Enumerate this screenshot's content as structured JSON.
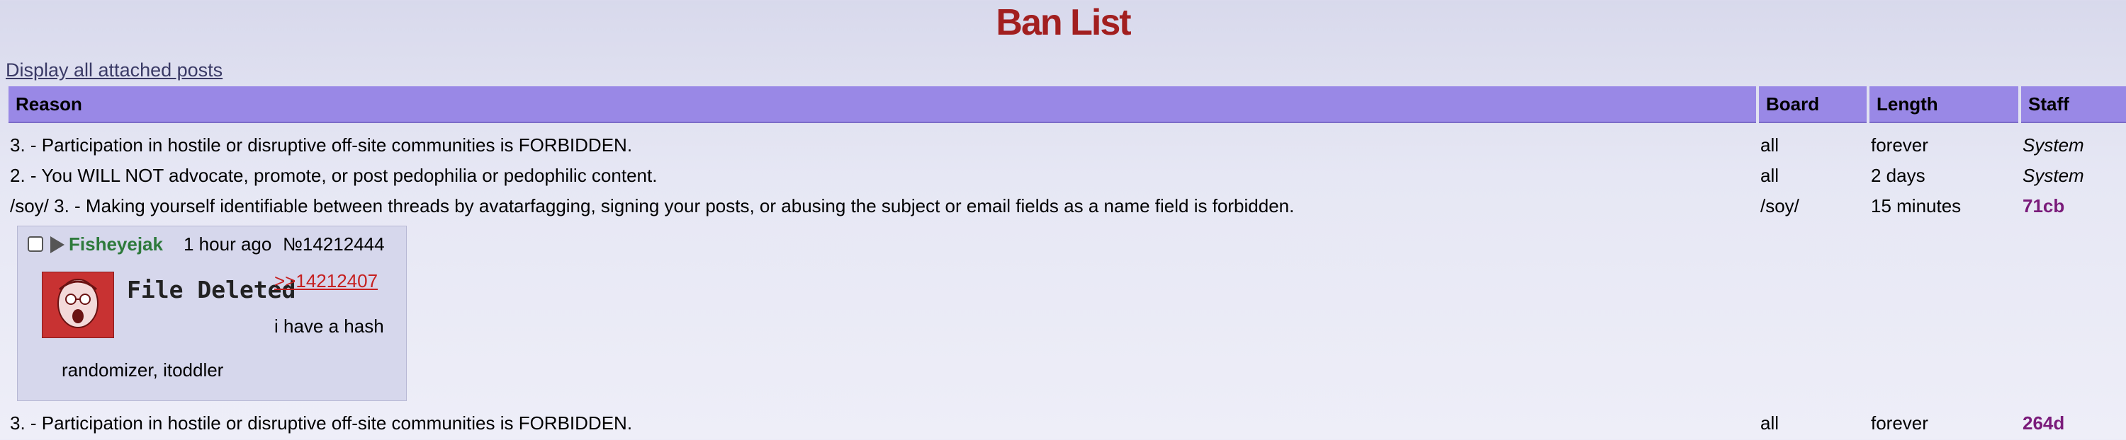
{
  "title": "Ban List",
  "display_link": "Display all attached posts",
  "columns": {
    "reason": "Reason",
    "board": "Board",
    "length": "Length",
    "staff": "Staff"
  },
  "bans": [
    {
      "reason": "3. - Participation in hostile or disruptive off-site communities is FORBIDDEN.",
      "board": "all",
      "length": "forever",
      "staff": "System"
    },
    {
      "reason": "2. - You WILL NOT advocate, promote, or post pedophilia or pedophilic content.",
      "board": "all",
      "length": "2 days",
      "staff": "System"
    },
    {
      "reason": "/soy/ 3. - Making yourself identifiable between threads by avatarfagging, signing your posts, or abusing the subject or email fields as a name field is forbidden.",
      "board": "/soy/",
      "length": "15 minutes",
      "staff": "71cb"
    },
    {
      "reason": "3. - Participation in hostile or disruptive off-site communities is FORBIDDEN.",
      "board": "all",
      "length": "forever",
      "staff": "264d"
    }
  ],
  "post": {
    "name": "Fisheyejak",
    "time": "1 hour ago",
    "number": "№14212444",
    "file_status": "File Deleted",
    "quote": ">>14212407",
    "body_line1": "i have a hash",
    "body_line2": "randomizer, itoddler"
  },
  "colors": {
    "title": "#a21f1f",
    "header_bg": "#9988e6",
    "staff_user": "#7a1b7a",
    "poster_name": "#2e7a3c",
    "quote_link": "#c62020"
  }
}
